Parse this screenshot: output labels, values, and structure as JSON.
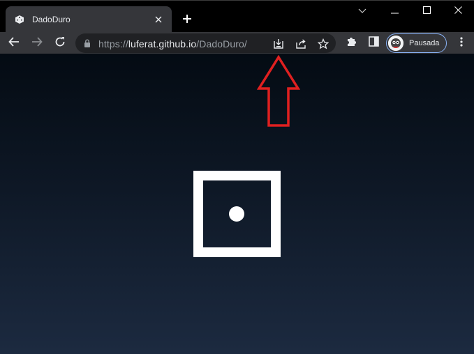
{
  "tab": {
    "title": "DadoDuro",
    "favicon": "dice-icon"
  },
  "window_controls": [
    "chevron-down-icon",
    "minimize-icon",
    "maximize-icon",
    "close-icon"
  ],
  "address_bar": {
    "scheme": "https://",
    "host": "luferat.github.io",
    "path": "/DadoDuro/"
  },
  "profile": {
    "label": "Pausada"
  },
  "die": {
    "face_value": 1
  },
  "annotation": {
    "type": "red-arrow-up",
    "color": "#e02020",
    "target": "install-app-icon"
  },
  "colors": {
    "tab_strip": "#000000",
    "toolbar": "#35363a",
    "omnibox": "#202124",
    "accent": "#8ab4f8",
    "page_top": "#040b13",
    "page_bottom": "#1c2a40",
    "die": "#ffffff"
  }
}
